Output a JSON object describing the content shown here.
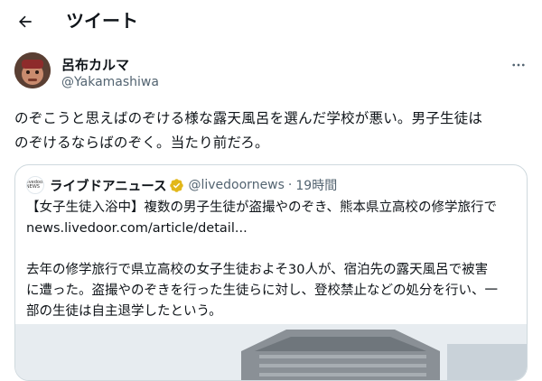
{
  "header": {
    "title": "ツイート",
    "back_icon": "arrow-left-icon"
  },
  "author": {
    "name": "呂布カルマ",
    "handle": "@Yakamashiwa",
    "more_icon": "ellipsis-icon"
  },
  "tweet": {
    "text": "のぞこうと思えばのぞける様な露天風呂を選んだ学校が悪い。男子生徒は\nのぞけるならばのぞく。当たり前だろ。"
  },
  "quote": {
    "avatar_text": "livedoor NEWS",
    "name": "ライブドアニュース",
    "handle": "@livedoornews",
    "dot": "·",
    "time": "19時間",
    "text": "【女子生徒入浴中】複数の男子生徒が盗撮やのぞき、熊本県立高校の修学旅行で\nnews.livedoor.com/article/detail...\n\n去年の修学旅行で県立高校の女子生徒およそ30人が、宿泊先の露天風呂で被害\nに遭った。盗撮やのぞきを行った生徒らに対し、登校禁止などの処分を行い、一\n部の生徒は自主退学したという。",
    "verified_color": "#e2b719"
  }
}
